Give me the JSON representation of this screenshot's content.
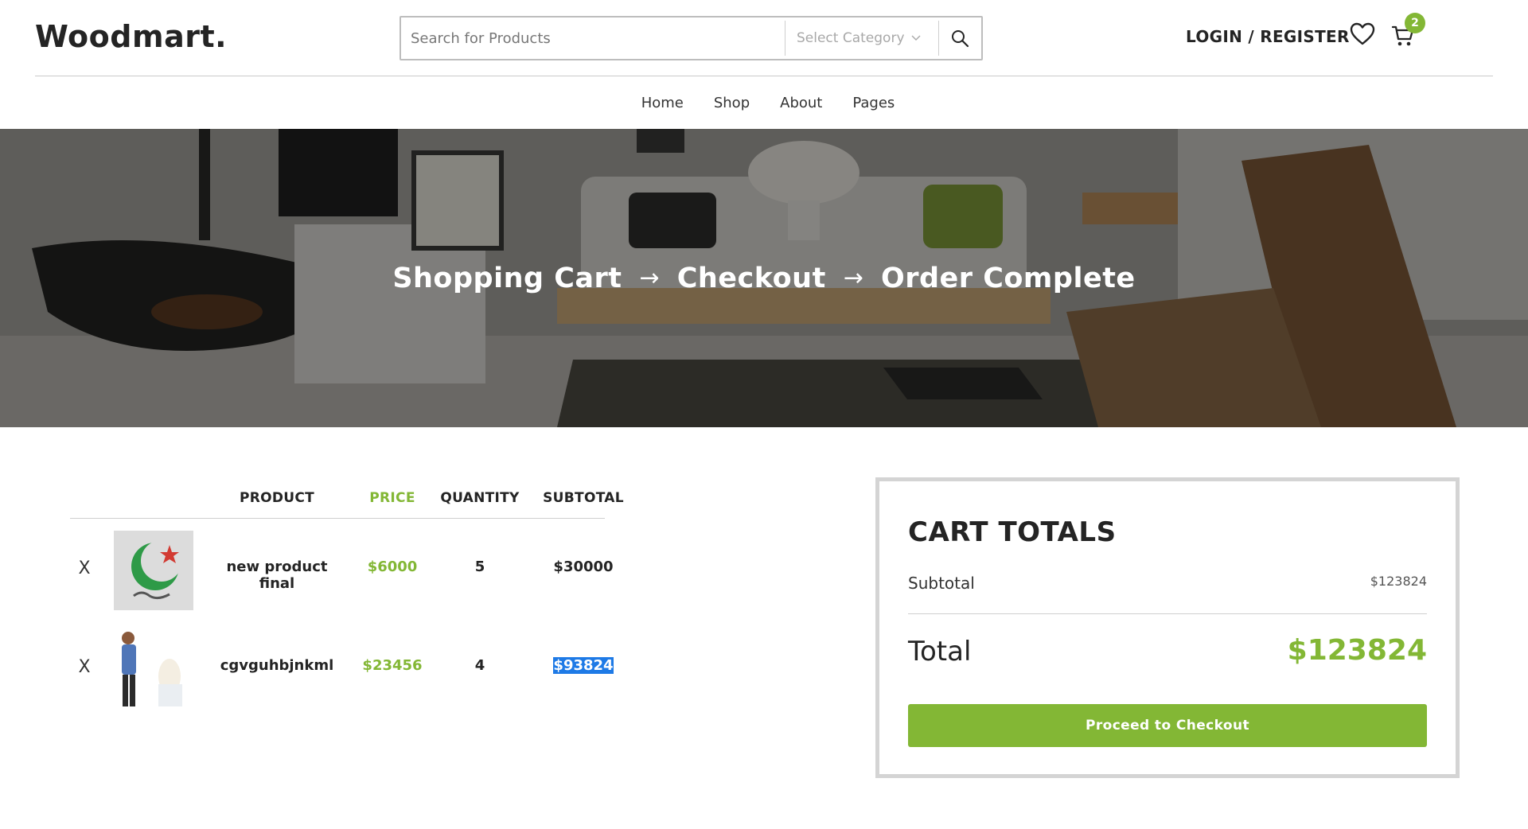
{
  "header": {
    "logo": "Woodmart.",
    "search_placeholder": "Search for Products",
    "category_label": "Select Category",
    "login_label": "LOGIN / REGISTER",
    "cart_count": "2"
  },
  "nav": {
    "items": [
      {
        "label": "Home"
      },
      {
        "label": "Shop"
      },
      {
        "label": "About"
      },
      {
        "label": "Pages"
      }
    ]
  },
  "hero": {
    "steps": [
      "Shopping Cart",
      "Checkout",
      "Order Complete"
    ],
    "arrow": "→"
  },
  "cart": {
    "columns": {
      "product": "PRODUCT",
      "price": "PRICE",
      "quantity": "QUANTITY",
      "subtotal": "SUBTOTAL"
    },
    "remove_symbol": "X",
    "rows": [
      {
        "name": "new product final",
        "price": "$6000",
        "quantity": "5",
        "subtotal": "$30000"
      },
      {
        "name": "cgvguhbjnkml",
        "price": "$23456",
        "quantity": "4",
        "subtotal": "$93824"
      }
    ]
  },
  "totals": {
    "title": "CART TOTALS",
    "subtotal_label": "Subtotal",
    "subtotal_value": "$123824",
    "total_label": "Total",
    "total_value": "$123824",
    "checkout_label": "Proceed to Checkout"
  },
  "colors": {
    "accent": "#83b735",
    "text": "#242424",
    "selection": "#1e7ae6"
  }
}
